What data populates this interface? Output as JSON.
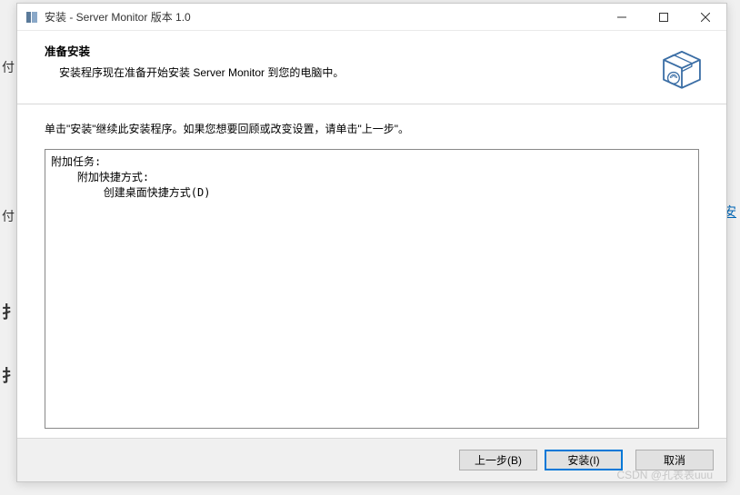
{
  "titlebar": {
    "title": "安装 - Server Monitor 版本 1.0"
  },
  "header": {
    "heading": "准备安装",
    "subheading": "安装程序现在准备开始安装 Server Monitor 到您的电脑中。"
  },
  "content": {
    "instruction": "单击\"安装\"继续此安装程序。如果您想要回顾或改变设置，请单击\"上一步\"。",
    "summary": "附加任务:\n    附加快捷方式:\n        创建桌面快捷方式(D)"
  },
  "buttons": {
    "back": "上一步(B)",
    "install": "安装(I)",
    "cancel": "取消"
  },
  "watermark": "CSDN @孔表表uuu",
  "bg": {
    "frag1": "付",
    "frag2": "安",
    "frag3": "付",
    "frag4": "扌",
    "frag5": "扌"
  }
}
